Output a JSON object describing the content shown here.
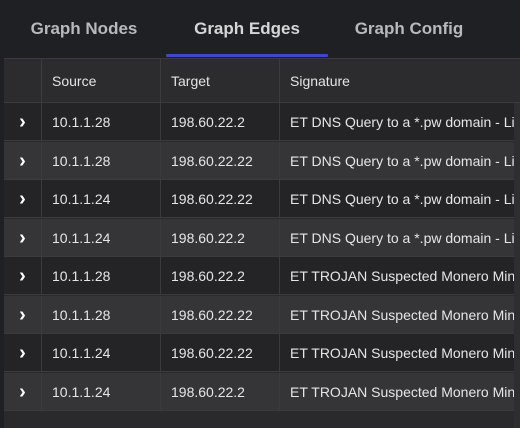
{
  "tabs": [
    {
      "label": "Graph Nodes",
      "active": false
    },
    {
      "label": "Graph Edges",
      "active": true
    },
    {
      "label": "Graph Config",
      "active": false
    }
  ],
  "accent_color": "#3b48c8",
  "table": {
    "columns": [
      "Source",
      "Target",
      "Signature"
    ],
    "expand_icon": "chevron-right-icon",
    "rows": [
      {
        "source": "10.1.1.28",
        "target": "198.60.22.2",
        "signature": "ET DNS Query to a *.pw domain - Likely Hostile"
      },
      {
        "source": "10.1.1.28",
        "target": "198.60.22.22",
        "signature": "ET DNS Query to a *.pw domain - Likely Hostile"
      },
      {
        "source": "10.1.1.24",
        "target": "198.60.22.22",
        "signature": "ET DNS Query to a *.pw domain - Likely Hostile"
      },
      {
        "source": "10.1.1.24",
        "target": "198.60.22.2",
        "signature": "ET DNS Query to a *.pw domain - Likely Hostile"
      },
      {
        "source": "10.1.1.28",
        "target": "198.60.22.2",
        "signature": "ET TROJAN Suspected Monero Miner CnC Beacon"
      },
      {
        "source": "10.1.1.28",
        "target": "198.60.22.22",
        "signature": "ET TROJAN Suspected Monero Miner CnC Beacon"
      },
      {
        "source": "10.1.1.24",
        "target": "198.60.22.22",
        "signature": "ET TROJAN Suspected Monero Miner CnC Beacon"
      },
      {
        "source": "10.1.1.24",
        "target": "198.60.22.2",
        "signature": "ET TROJAN Suspected Monero Miner CnC Beacon"
      }
    ]
  }
}
